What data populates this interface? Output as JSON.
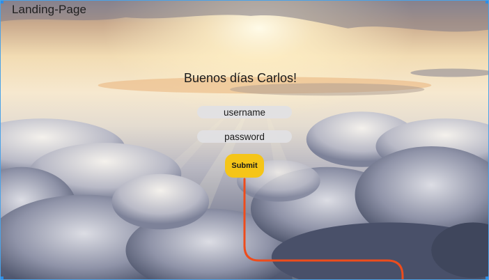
{
  "frame": {
    "title": "Landing-Page"
  },
  "page": {
    "greeting": "Buenos días Carlos!"
  },
  "form": {
    "username_placeholder": "username",
    "password_placeholder": "password",
    "submit_label": "Submit"
  },
  "colors": {
    "selection_border": "#4aa3e8",
    "submit_background": "#f5c518",
    "prototype_connector": "#ee4c1c",
    "field_background": "#e1e1e4"
  },
  "icons": {
    "background": "sky-clouds-sunrise-image"
  }
}
